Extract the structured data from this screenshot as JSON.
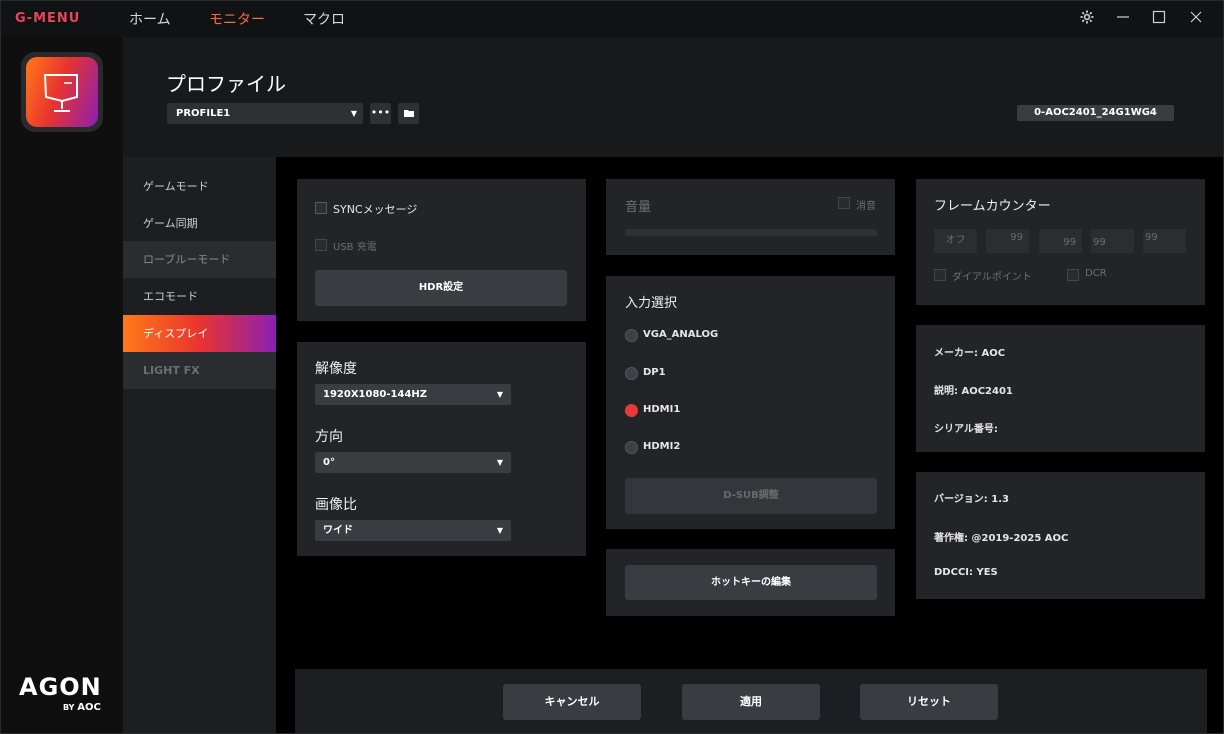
{
  "app": {
    "brand": "G-MENU",
    "nav": [
      "ホーム",
      "モニター",
      "マクロ"
    ],
    "active_nav": "モニター",
    "window_controls": [
      "gear-icon",
      "minimize-icon",
      "maximize-icon",
      "close-icon"
    ]
  },
  "header": {
    "title": "プロファイル",
    "profile": "PROFILE1",
    "more_label": "•••",
    "monitor_id": "0-AOC2401_24G1WG4"
  },
  "sidebar": {
    "items": [
      {
        "label": "ゲームモード",
        "state": "normal"
      },
      {
        "label": "ゲーム同期",
        "state": "normal"
      },
      {
        "label": "ローブルーモード",
        "state": "dim"
      },
      {
        "label": "エコモード",
        "state": "normal"
      },
      {
        "label": "ディスプレイ",
        "state": "active"
      },
      {
        "label": "LIGHT FX",
        "state": "disabled"
      }
    ],
    "brand": {
      "main": "AGON",
      "sub": "BY",
      "sub2": "AOC"
    }
  },
  "sync_panel": {
    "sync_label": "SYNCメッセージ",
    "usb_label": "USB 充電",
    "hdr_button": "HDR設定"
  },
  "display_panel": {
    "resolution_label": "解像度",
    "resolution_value": "1920X1080-144HZ",
    "orientation_label": "方向",
    "orientation_value": "0°",
    "aspect_label": "画像比",
    "aspect_value": "ワイド"
  },
  "volume_panel": {
    "label": "音量",
    "mute_label": "消音",
    "level": 0
  },
  "input_panel": {
    "title": "入力選択",
    "options": [
      "VGA_ANALOG",
      "DP1",
      "HDMI1",
      "HDMI2"
    ],
    "selected": "HDMI1",
    "dsub_button": "D-SUB調整"
  },
  "hotkey_panel": {
    "button": "ホットキーの編集"
  },
  "frame_counter": {
    "title": "フレームカウンター",
    "off_label": "オフ",
    "values": [
      "99",
      "99",
      "99",
      "99"
    ],
    "dial_point_label": "ダイアルポイント",
    "dcr_label": "DCR"
  },
  "info_panel": {
    "maker": "メーカー: AOC",
    "description": "説明: AOC2401",
    "serial": "シリアル番号:"
  },
  "version_panel": {
    "version": "バージョン: 1.3",
    "copyright": "著作権: @2019-2025 AOC",
    "ddcci": "DDCCI: YES"
  },
  "footer": {
    "cancel": "キャンセル",
    "apply": "適用",
    "reset": "リセット"
  },
  "colors": {
    "accent_orange": "#ff6a3d",
    "brand_red": "#e8455a",
    "selected_radio": "#e83a3a",
    "gradient": [
      "#ff7a18",
      "#e8342f",
      "#8a1fb5"
    ]
  }
}
